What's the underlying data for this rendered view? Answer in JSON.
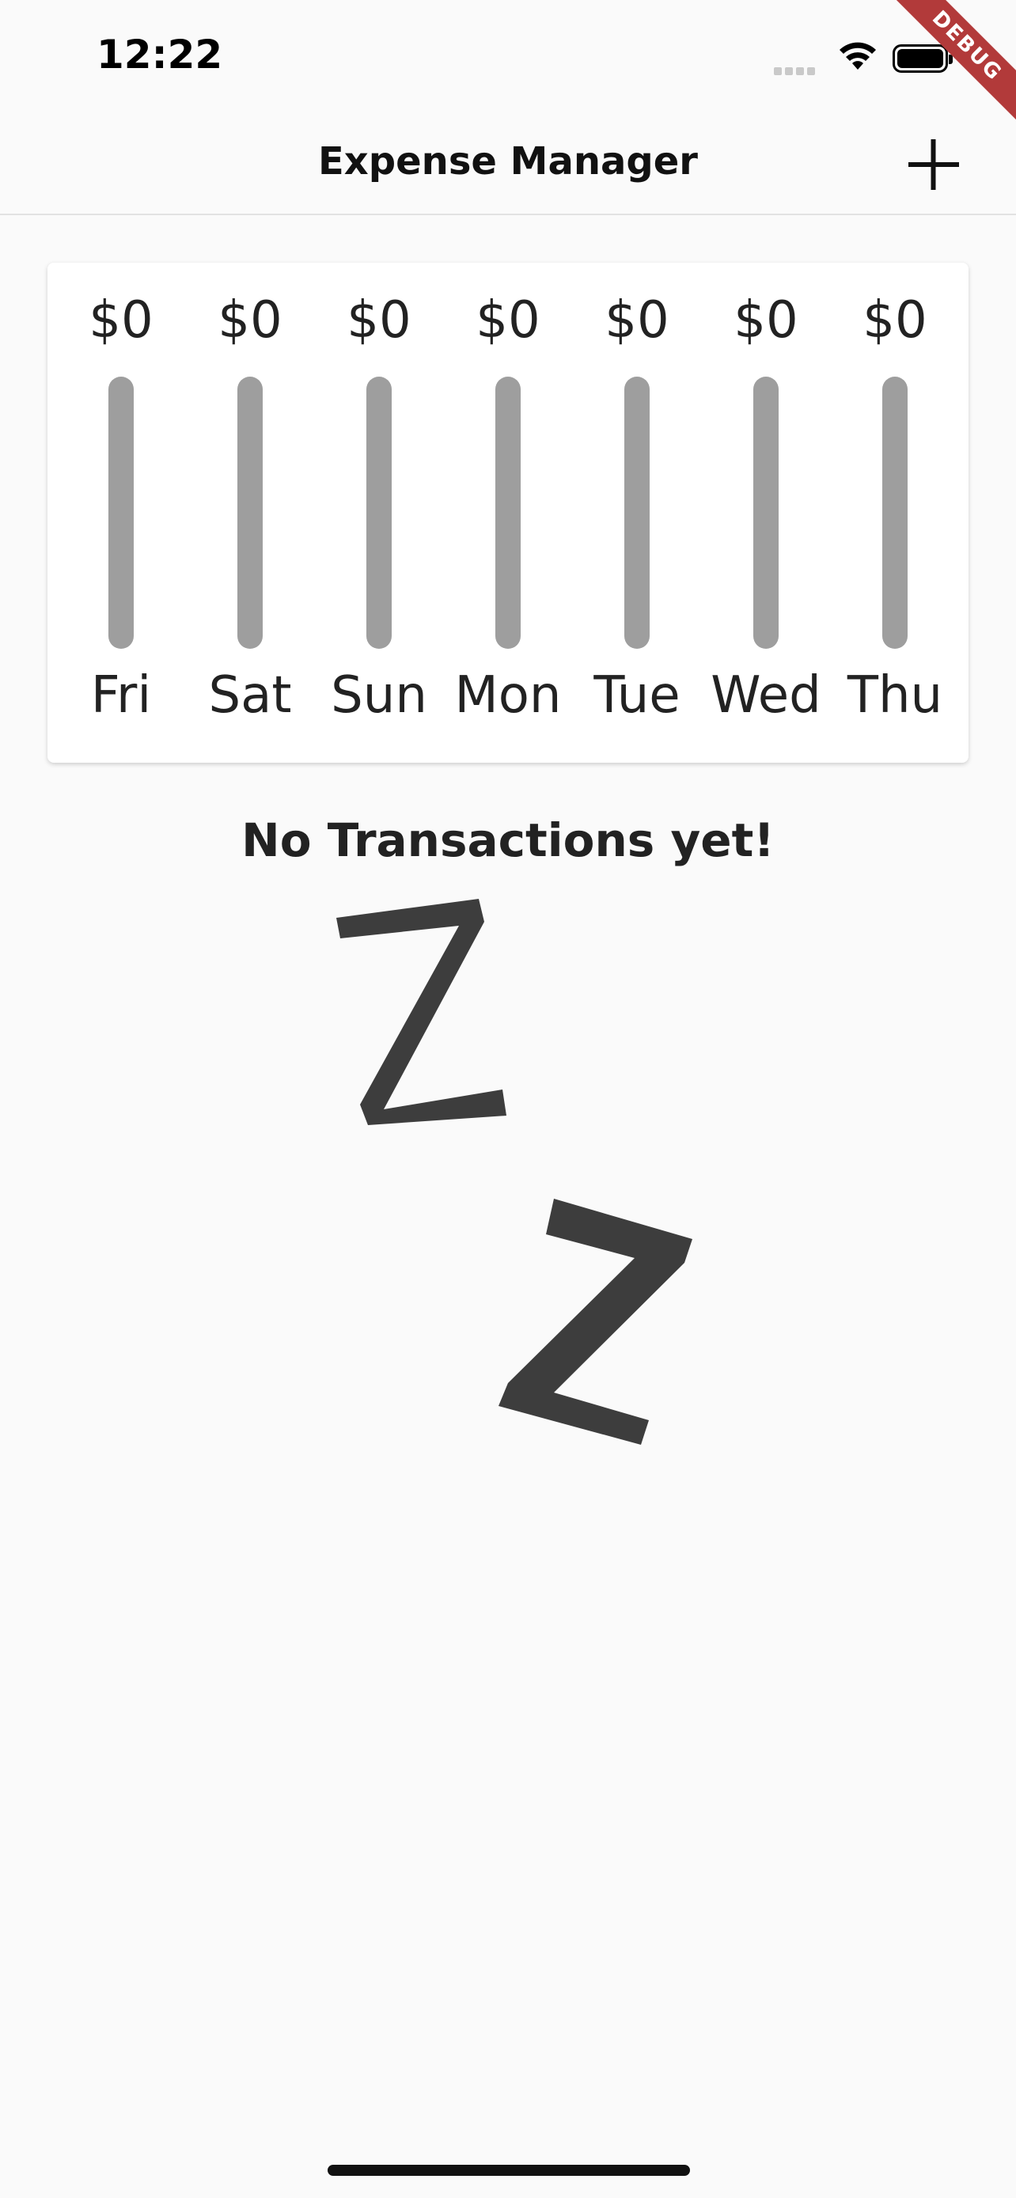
{
  "status_bar": {
    "time": "12:22"
  },
  "debug_banner": "DEBUG",
  "app_bar": {
    "title": "Expense Manager",
    "add_icon": "plus-icon"
  },
  "chart_data": {
    "type": "bar",
    "categories": [
      "Fri",
      "Sat",
      "Sun",
      "Mon",
      "Tue",
      "Wed",
      "Thu"
    ],
    "values": [
      0,
      0,
      0,
      0,
      0,
      0,
      0
    ],
    "labels": [
      "$0",
      "$0",
      "$0",
      "$0",
      "$0",
      "$0",
      "$0"
    ],
    "fill_fraction": [
      0,
      0,
      0,
      0,
      0,
      0,
      0
    ]
  },
  "empty_state": {
    "title": "No Transactions yet!",
    "illustration": "sleeping-zzz-image"
  },
  "colors": {
    "background": "#fafafa",
    "bar_track": "#9e9e9e",
    "text": "#222222",
    "illustration": "#3d3d3d",
    "debug_ribbon": "#b23a3a"
  }
}
